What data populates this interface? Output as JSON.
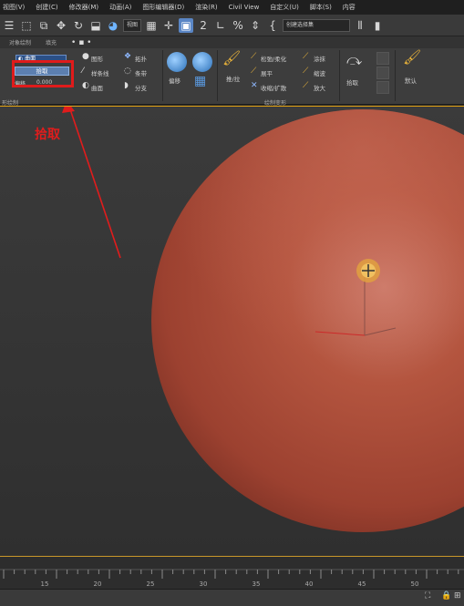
{
  "menu": [
    "视图(V)",
    "创建(C)",
    "修改器(M)",
    "动画(A)",
    "图形编辑器(D)",
    "渲染(R)",
    "Civil View",
    "自定义(U)",
    "脚本(S)",
    "内容"
  ],
  "toolbar": {
    "view_dropdown": "视图",
    "selection_set_dropdown": "创建选择集"
  },
  "ribbon_tabs": {
    "object_paint": "对象绘制",
    "populate": "填充",
    "more": "• ▪ •"
  },
  "ribbon": {
    "surface_dropdown": "曲面",
    "pick_button": "拾取",
    "offset_label": "偏移",
    "offset_value": "0.000",
    "shape": "图形",
    "spline": "样条线",
    "surface": "曲面",
    "topology": "拓扑",
    "strip": "条带",
    "branch": "分支",
    "offset_tool": "偏移",
    "push_pull": "推/拉",
    "relax_soften": "松弛/柔化",
    "flatten": "展平",
    "shrink_grow": "收缩/扩散",
    "smear": "涂抹",
    "reduce": "缩波",
    "expand": "放大",
    "pick_tool": "拾取",
    "default": "默认",
    "section_freeform": "形绘制",
    "section_paint_deform": "绘制变形"
  },
  "annotation": {
    "label": "拾取",
    "color": "#e11c1c"
  },
  "timeline": {
    "ticks": [
      "15",
      "20",
      "25",
      "30",
      "35",
      "40",
      "45",
      "50"
    ]
  },
  "colors": {
    "sphere": "#b24e38",
    "accent_orange": "#e0a010",
    "highlight_blue": "#5c7fb0"
  }
}
